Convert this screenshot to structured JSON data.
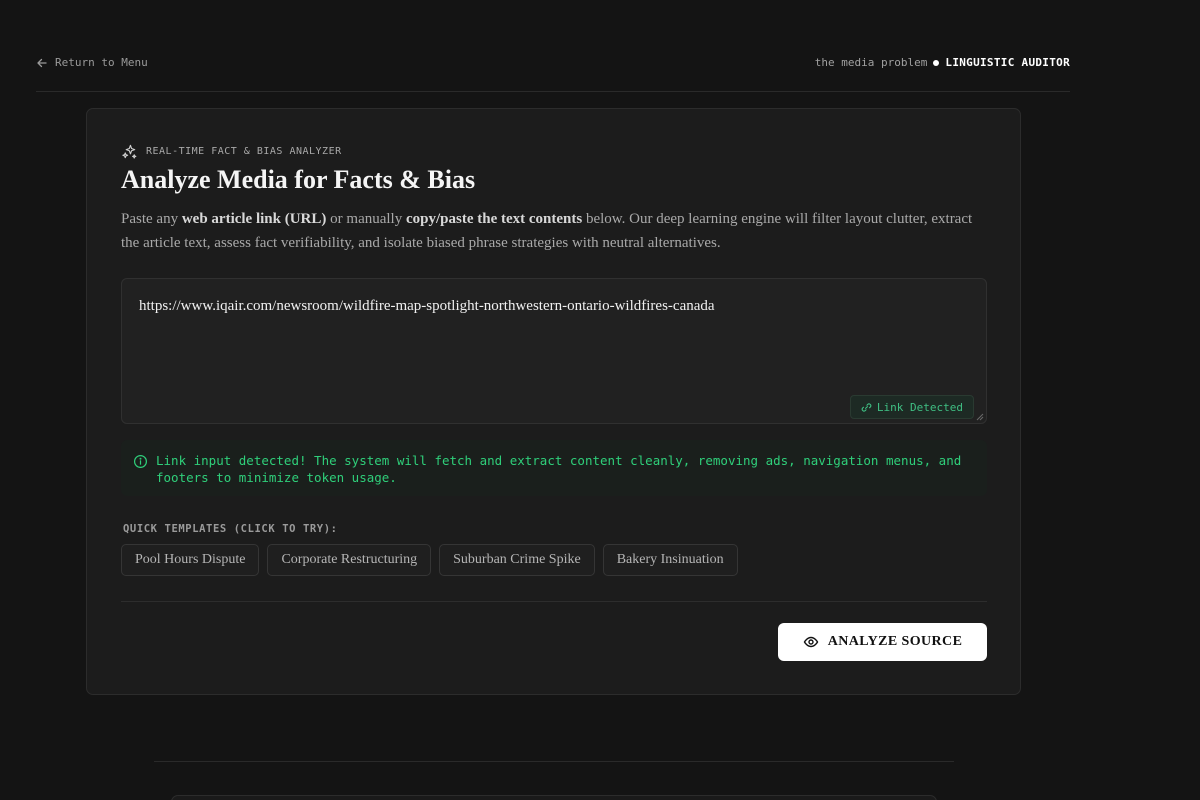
{
  "nav": {
    "back_label": "Return to Menu",
    "brand_sub": "the media problem",
    "brand_main": "LINGUISTIC AUDITOR"
  },
  "card": {
    "eyebrow": "REAL-TIME FACT & BIAS ANALYZER",
    "title": "Analyze Media for Facts & Bias",
    "desc": {
      "p1": "Paste any ",
      "b1": "web article link (URL)",
      "p2": " or manually ",
      "b2": "copy/paste the text contents",
      "p3": " below. Our deep learning engine will filter layout clutter, extract the article text, assess fact verifiability, and isolate biased phrase strategies with neutral alternatives."
    },
    "input_value": "https://www.iqair.com/newsroom/wildfire-map-spotlight-northwestern-ontario-wildfires-canada",
    "link_badge": "Link Detected",
    "notice": "Link input detected! The system will fetch and extract content cleanly, removing ads, navigation menus, and footers to minimize token usage.",
    "templates_label": "QUICK TEMPLATES (CLICK TO TRY):",
    "templates": [
      "Pool Hours Dispute",
      "Corporate Restructuring",
      "Suburban Crime Spike",
      "Bakery Insinuation"
    ],
    "analyze_label": "ANALYZE SOURCE"
  },
  "colors": {
    "accent_green": "#2fcf7a",
    "background": "#141414",
    "card": "#1c1c1c"
  },
  "icons": [
    "arrow-left-icon",
    "sparkles-icon",
    "link-icon",
    "info-icon",
    "eye-icon"
  ]
}
